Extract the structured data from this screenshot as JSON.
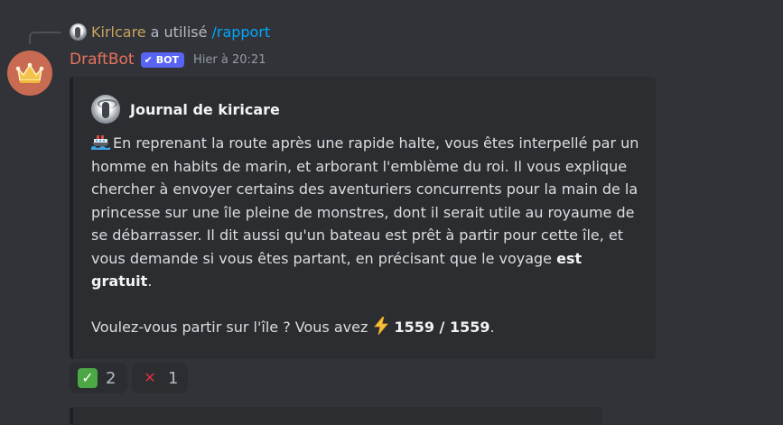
{
  "reply": {
    "user": "Kirlcare",
    "verb": "a utilisé",
    "command": "/rapport"
  },
  "message": {
    "username": "DraftBot",
    "badge": "BOT",
    "timestamp": "Hier à 20:21"
  },
  "embed": {
    "author": "Journal de kiricare",
    "paragraph1_pre": "En reprenant la route après une rapide halte, vous êtes interpellé par un homme en habits de marin, et arborant l'emblème du roi. Il vous explique chercher à envoyer certains des aventuriers concurrents pour la main de la princesse sur une île pleine de monstres, dont il serait utile au royaume de se débarrasser. Il dit aussi qu'un bateau est prêt à partir pour cette île, et vous demande si vous êtes partant, en précisant que le voyage ",
    "paragraph1_bold": "est gratuit",
    "paragraph1_post": ".",
    "question": "Voulez-vous partir sur l'île ? Vous avez",
    "energy": "1559 / 1559",
    "energy_post": ".",
    "accent_colors": {
      "border": "#1e1f22",
      "background": "#2b2d31"
    }
  },
  "reactions": [
    {
      "emoji": "white-check-mark-icon",
      "count": "2"
    },
    {
      "emoji": "cross-mark-icon",
      "count": "1"
    }
  ]
}
